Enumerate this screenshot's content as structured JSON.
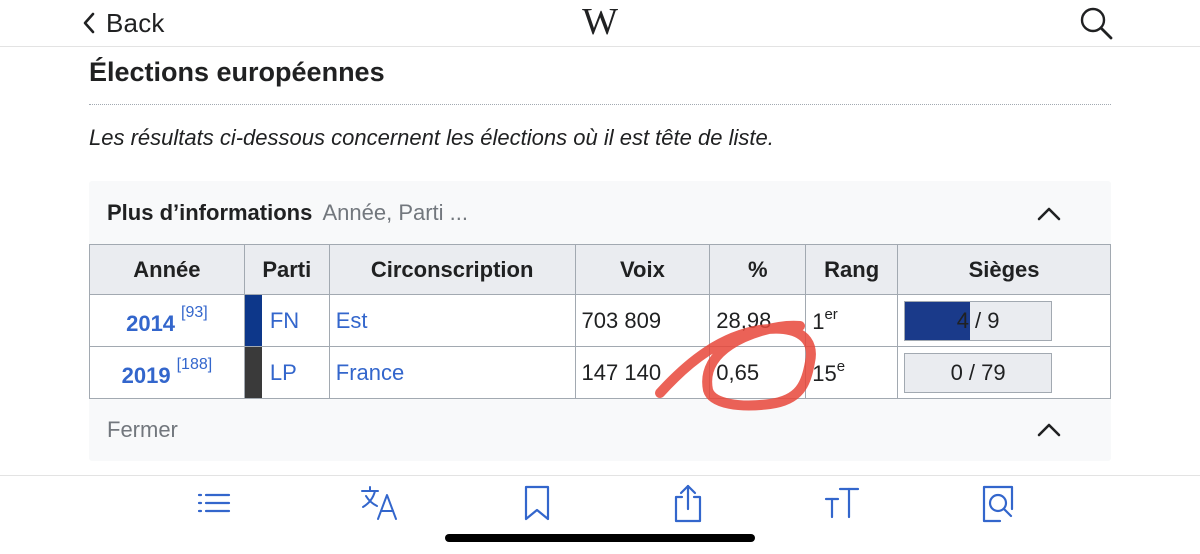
{
  "topbar": {
    "back_label": "Back",
    "logo": "W"
  },
  "section": {
    "title": "Élections européennes",
    "intro": "Les résultats ci-dessous concernent les élections où il est tête de liste."
  },
  "infobox": {
    "header_bold": "Plus d’informations",
    "header_muted": "Année, Parti ...",
    "footer_label": "Fermer",
    "columns": [
      "Année",
      "Parti",
      "Circonscription",
      "Voix",
      "%",
      "Rang",
      "Sièges"
    ],
    "rows": [
      {
        "year": "2014",
        "ref": "[93]",
        "party": "FN",
        "party_color": "#0d378a",
        "circonscription": "Est",
        "voix": "703 809",
        "pct": "28,98",
        "rang": "1",
        "rang_sup": "er",
        "seats_text": "4 / 9",
        "seats_won": 4,
        "seats_total": 9
      },
      {
        "year": "2019",
        "ref": "[188]",
        "party": "LP",
        "party_color": "#3a3a3a",
        "circonscription": "France",
        "voix": "147 140",
        "pct": "0,65",
        "rang": "15",
        "rang_sup": "e",
        "seats_text": "0 / 79",
        "seats_won": 0,
        "seats_total": 79
      }
    ]
  },
  "annotation_color": "#e8463a",
  "toolbar": {
    "icons": [
      "contents-icon",
      "language-icon",
      "bookmark-icon",
      "share-icon",
      "text-size-icon",
      "find-in-page-icon"
    ],
    "accent": "#3366cc"
  }
}
